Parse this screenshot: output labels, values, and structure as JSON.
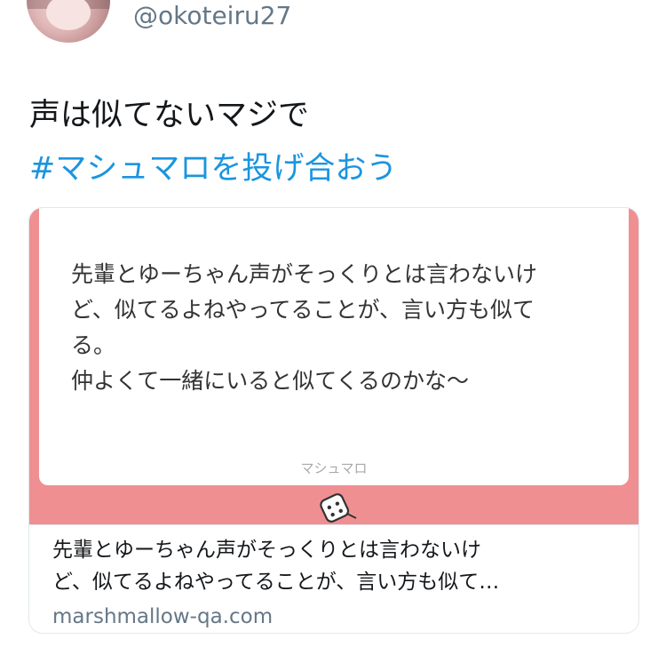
{
  "tweet": {
    "handle": "@okoteiru27",
    "text_line1": "声は似てないマジで",
    "hashtag": "#マシュマロを投げ合おう"
  },
  "card": {
    "body": "先輩とゆーちゃん声がそっくりとは言わないけ\nど、似てるよねやってることが、言い方も似て\nる。\n仲よくて一緒にいると似てくるのかな〜",
    "brand": "マシュマロ",
    "description_line1": "先輩とゆーちゃん声がそっくりとは言わないけ",
    "description_line2": "ど、似てるよねやってることが、言い方も似て…",
    "domain": "marshmallow-qa.com",
    "media_color": "#f08f92"
  },
  "colors": {
    "hashtag": "#1b95e0",
    "handle": "#657786"
  },
  "icons": {
    "card_logo": "marshmallow-icon"
  }
}
